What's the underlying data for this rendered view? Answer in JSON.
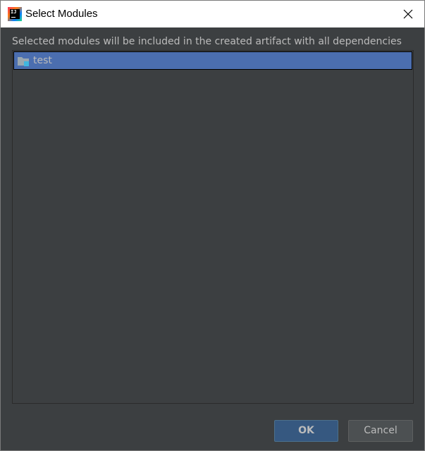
{
  "window": {
    "title": "Select Modules",
    "app_icon": "intellij-idea-icon",
    "app_icon_text": "IJ",
    "close_icon": "close-icon"
  },
  "dialog": {
    "description": "Selected modules will be included in the created artifact with all dependencies",
    "modules": [
      {
        "label": "test",
        "icon": "module-folder-icon",
        "selected": true
      }
    ]
  },
  "buttons": {
    "ok_label": "OK",
    "cancel_label": "Cancel"
  },
  "colors": {
    "dialog_background": "#3c3f41",
    "selection_background": "#4b6eaf",
    "text": "#bbbbbb",
    "ok_button": "#365880",
    "cancel_button": "#4c5052",
    "titlebar": "#ffffff"
  }
}
